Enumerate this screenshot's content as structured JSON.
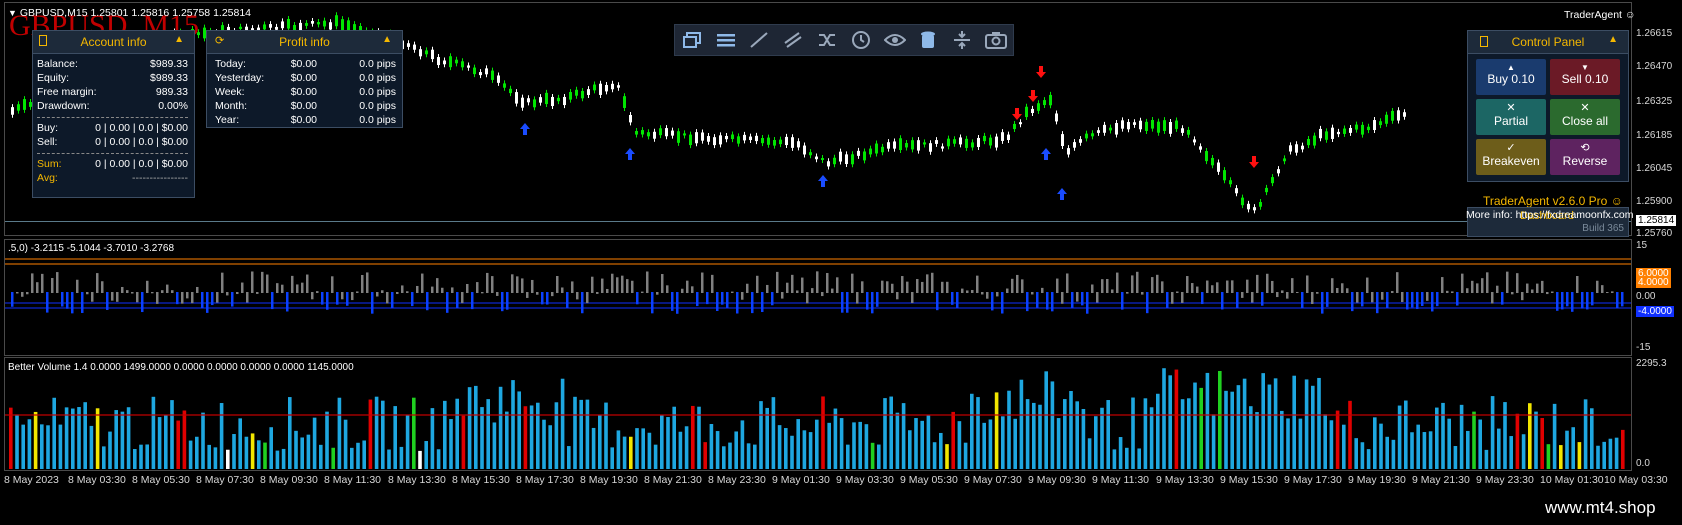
{
  "chart": {
    "symbol_header": "GBPUSD,M15  1.25801 1.25816 1.25758 1.25814",
    "watermark": "GBPUSD, M15",
    "brand": "TraderAgent",
    "price_ticks": [
      "1.26615",
      "1.26470",
      "1.26325",
      "1.26185",
      "1.26045",
      "1.25900",
      "1.25814",
      "1.25760"
    ],
    "current_price": "1.25814",
    "indicator1_header": ".5,0) -3.2115 -5.1044 -3.7010 -3.2768",
    "indicator1_scale": [
      "15",
      "6.0000",
      "4.0000",
      "0.00",
      "-4.0000",
      "-15"
    ],
    "indicator2_header": "Better Volume 1.4 0.0000 1499.0000 0.0000 0.0000 0.0000 0.0000 1145.0000",
    "indicator2_scale": [
      "2295.3",
      "0.0"
    ],
    "time_labels": [
      "8 May 2023",
      "8 May 03:30",
      "8 May 05:30",
      "8 May 07:30",
      "8 May 09:30",
      "8 May 11:30",
      "8 May 13:30",
      "8 May 15:30",
      "8 May 17:30",
      "8 May 19:30",
      "8 May 21:30",
      "8 May 23:30",
      "9 May 01:30",
      "9 May 03:30",
      "9 May 05:30",
      "9 May 07:30",
      "9 May 09:30",
      "9 May 11:30",
      "9 May 13:30",
      "9 May 15:30",
      "9 May 17:30",
      "9 May 19:30",
      "9 May 21:30",
      "9 May 23:30",
      "10 May 01:30",
      "10 May 03:30"
    ],
    "footer": "www.mt4.shop",
    "colors": {
      "bull": "#00e600",
      "bear": "#ffffff",
      "vol_blue": "#1ea7e0",
      "vol_red": "#e00000",
      "vol_yellow": "#f2e600",
      "vol_green": "#20d020",
      "vol_white": "#ffffff",
      "osc_orange": "#ff8000",
      "osc_blue": "#0a40ff",
      "osc_gray": "#808080"
    }
  },
  "toolbar": {
    "icons": [
      "windows-icon",
      "menu-icon",
      "line-icon",
      "channel-icon",
      "shuffle-icon",
      "clock-icon",
      "eye-icon",
      "trash-icon",
      "level-icon",
      "camera-icon"
    ]
  },
  "account_info": {
    "title": "Account info",
    "rows": [
      {
        "label": "Balance:",
        "value": "$989.33"
      },
      {
        "label": "Equity:",
        "value": "$989.33"
      },
      {
        "label": "Free margin:",
        "value": "989.33"
      },
      {
        "label": "Drawdown:",
        "value": "0.00%"
      }
    ],
    "trade_rows": [
      {
        "label": "Buy:",
        "value": "0 | 0.00 | 0.0 | $0.00"
      },
      {
        "label": "Sell:",
        "value": "0 | 0.00 | 0.0 | $0.00"
      }
    ],
    "sum_label": "Sum:",
    "sum_value": "0 | 0.00 | 0.0 | $0.00",
    "avg_label": "Avg:",
    "avg_value": "----------------"
  },
  "profit_info": {
    "title": "Profit info",
    "rows": [
      {
        "label": "Today:",
        "money": "$0.00",
        "pips": "0.0 pips"
      },
      {
        "label": "Yesterday:",
        "money": "$0.00",
        "pips": "0.0 pips"
      },
      {
        "label": "Week:",
        "money": "$0.00",
        "pips": "0.0 pips"
      },
      {
        "label": "Month:",
        "money": "$0.00",
        "pips": "0.0 pips"
      },
      {
        "label": "Year:",
        "money": "$0.00",
        "pips": "0.0 pips"
      }
    ]
  },
  "control_panel": {
    "title": "Control Panel",
    "buy": "Buy 0.10",
    "sell": "Sell 0.10",
    "partial": "Partial",
    "close_all": "Close all",
    "breakeven": "Breakeven",
    "reverse": "Reverse",
    "version": "TraderAgent v2.6.0 Pro",
    "more_info": "More info: https://fxdreamoonfx.com",
    "dashboard": "Dashboard",
    "build": "Build 365"
  }
}
